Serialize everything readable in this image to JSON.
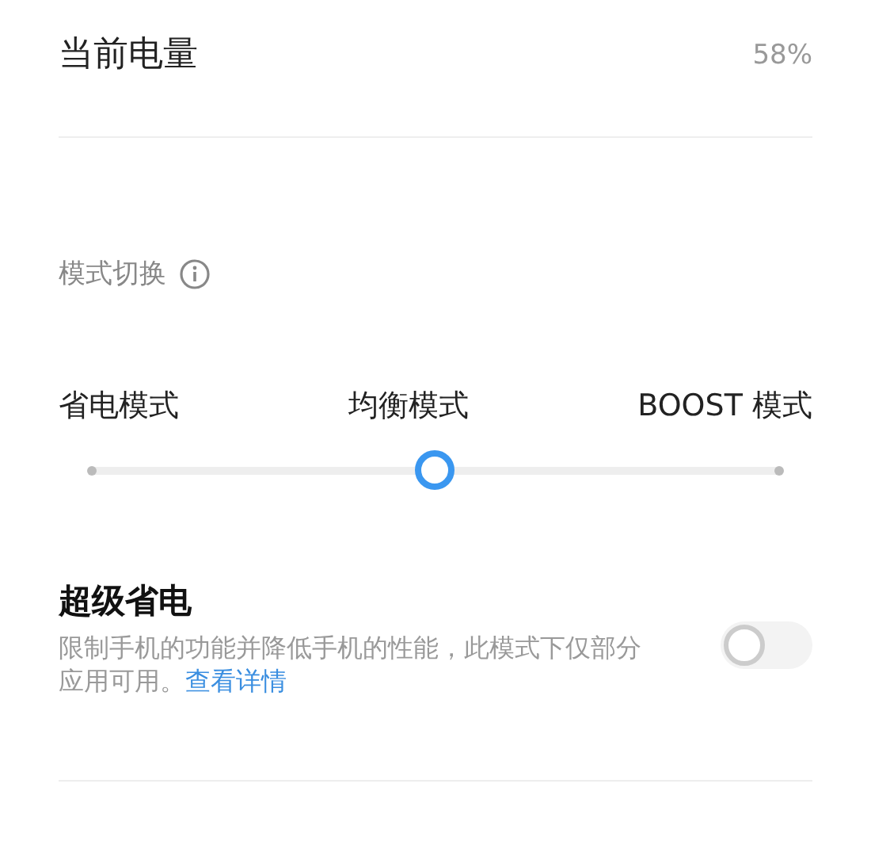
{
  "battery": {
    "label": "当前电量",
    "value": "58%"
  },
  "mode_switch": {
    "title": "模式切换",
    "modes": [
      "省电模式",
      "均衡模式",
      "BOOST 模式"
    ],
    "level": 0.5
  },
  "super_saver": {
    "title": "超级省电",
    "description": "限制手机的功能并降低手机的性能，此模式下仅部分应用可用。",
    "link": "查看详情",
    "on": false
  }
}
